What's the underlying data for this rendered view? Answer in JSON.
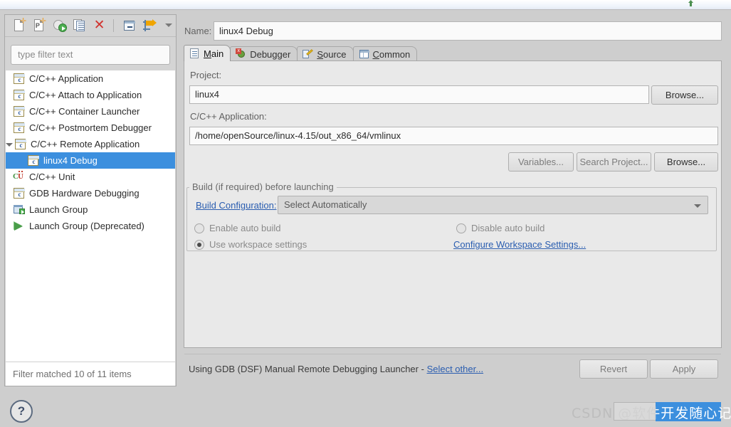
{
  "toolbar": {
    "buttons": [
      {
        "name": "new-launch-configuration-icon",
        "label": "New launch configuration"
      },
      {
        "name": "new-launch-configuration-prototype-icon",
        "label": "New launch configuration prototype"
      },
      {
        "name": "export-launch-configuration-icon",
        "label": "Export launch configuration"
      },
      {
        "name": "duplicate-launch-configuration-icon",
        "label": "Duplicate launch configuration"
      },
      {
        "name": "delete-launch-configuration-icon",
        "label": "Delete launch configuration"
      },
      {
        "name": "collapse-all-icon",
        "label": "Collapse All"
      },
      {
        "name": "filter-launch-configurations-icon",
        "label": "Filter launch configurations"
      },
      {
        "name": "view-menu-chevron-icon",
        "label": "View Menu"
      }
    ]
  },
  "filter": {
    "placeholder": "type filter text",
    "status": "Filter matched 10 of 11 items"
  },
  "tree": {
    "items": [
      {
        "label": "C/C++ Application",
        "icon": "c-config-icon",
        "indent": 0,
        "selected": false,
        "twisty": false
      },
      {
        "label": "C/C++ Attach to Application",
        "icon": "c-config-icon",
        "indent": 0,
        "selected": false,
        "twisty": false
      },
      {
        "label": "C/C++ Container Launcher",
        "icon": "c-config-icon",
        "indent": 0,
        "selected": false,
        "twisty": false
      },
      {
        "label": "C/C++ Postmortem Debugger",
        "icon": "c-config-icon",
        "indent": 0,
        "selected": false,
        "twisty": false
      },
      {
        "label": "C/C++ Remote Application",
        "icon": "c-config-icon",
        "indent": 0,
        "selected": false,
        "twisty": true
      },
      {
        "label": "linux4 Debug",
        "icon": "c-config-icon",
        "indent": 1,
        "selected": true,
        "twisty": false
      },
      {
        "label": "C/C++ Unit",
        "icon": "cunit-icon",
        "indent": 0,
        "selected": false,
        "twisty": false
      },
      {
        "label": "GDB Hardware Debugging",
        "icon": "c-config-icon",
        "indent": 0,
        "selected": false,
        "twisty": false
      },
      {
        "label": "Launch Group",
        "icon": "launch-group-icon",
        "indent": 0,
        "selected": false,
        "twisty": false
      },
      {
        "label": "Launch Group (Deprecated)",
        "icon": "play-icon",
        "indent": 0,
        "selected": false,
        "twisty": false
      }
    ]
  },
  "name_field": {
    "label": "Name:",
    "value": "linux4 Debug"
  },
  "tabs": [
    {
      "label": "Main",
      "mnemonic": "M",
      "icon": "main-document-icon",
      "active": true
    },
    {
      "label": "Debugger",
      "mnemonic": "",
      "icon": "debugger-bug-icon",
      "active": false
    },
    {
      "label": "Source",
      "mnemonic": "S",
      "icon": "source-pencil-icon",
      "active": false
    },
    {
      "label": "Common",
      "mnemonic": "C",
      "icon": "common-table-icon",
      "active": false
    }
  ],
  "main_tab": {
    "project": {
      "label": "Project:",
      "value": "linux4",
      "browse_label": "Browse..."
    },
    "application": {
      "label": "C/C++ Application:",
      "value": "/home/openSource/linux-4.15/out_x86_64/vmlinux",
      "variables_label": "Variables...",
      "search_project_label": "Search Project...",
      "browse_label": "Browse..."
    },
    "build_group": {
      "title": "Build (if required) before launching",
      "build_configuration_label": "Build Configuration:",
      "build_configuration_value": "Select Automatically",
      "radios": [
        {
          "label": "Enable auto build",
          "checked": false
        },
        {
          "label": "Disable auto build",
          "checked": false
        },
        {
          "label": "Use workspace settings",
          "checked": true
        }
      ],
      "configure_workspace_link": "Configure Workspace Settings..."
    }
  },
  "footer": {
    "launcher_text": "Using GDB (DSF) Manual Remote Debugging Launcher -",
    "select_other_link": "Select other...",
    "revert_label": "Revert",
    "apply_label": "Apply",
    "help_label": "?"
  },
  "watermark": {
    "text": "CSDN @软件开发随心记"
  },
  "colors": {
    "selection_blue": "#3c8fde",
    "link_blue": "#2a5db0",
    "panel_bg": "#e9e9e9",
    "window_bg": "#cecece"
  }
}
